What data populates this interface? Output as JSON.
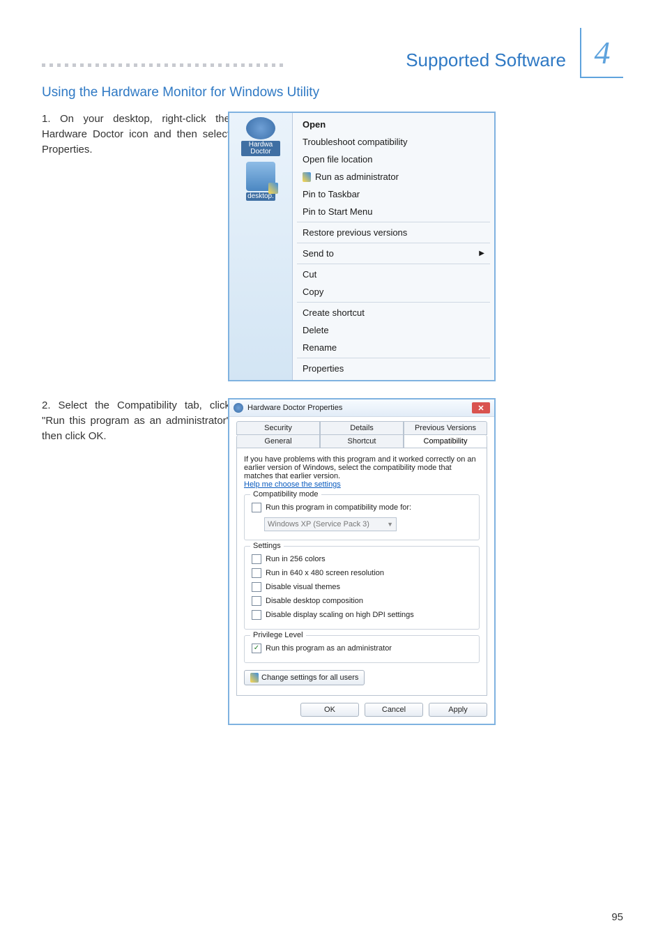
{
  "chapter": {
    "title": "Supported Software",
    "number": "4"
  },
  "section_title": "Using the Hardware Monitor for Windows Utility",
  "step1": {
    "num": "1.",
    "text": "On your desktop, right-click the Hardware Doctor icon and then select Properties."
  },
  "desktop": {
    "hardware_icon_label": "Hardwa\nDoctor",
    "desktop_icon_label": "desktop."
  },
  "context_menu": {
    "open": "Open",
    "troubleshoot": "Troubleshoot compatibility",
    "open_loc": "Open file location",
    "run_admin": "Run as administrator",
    "pin_taskbar": "Pin to Taskbar",
    "pin_start": "Pin to Start Menu",
    "restore": "Restore previous versions",
    "send_to": "Send to",
    "cut": "Cut",
    "copy": "Copy",
    "create_shortcut": "Create shortcut",
    "delete": "Delete",
    "rename": "Rename",
    "properties": "Properties"
  },
  "step2": {
    "num": "2.",
    "text": "Select the Compatibility tab, click \"Run this program as an administrator\" then click OK."
  },
  "dialog": {
    "title": "Hardware Doctor Properties",
    "tabs": {
      "security": "Security",
      "details": "Details",
      "previous": "Previous Versions",
      "general": "General",
      "shortcut": "Shortcut",
      "compatibility": "Compatibility"
    },
    "hint": "If you have problems with this program and it worked correctly on an earlier version of Windows, select the compatibility mode that matches that earlier version.",
    "help_link": "Help me choose the settings",
    "group_compat": "Compatibility mode",
    "chk_compat": "Run this program in compatibility mode for:",
    "compat_option": "Windows XP (Service Pack 3)",
    "group_settings": "Settings",
    "chk_256": "Run in 256 colors",
    "chk_640": "Run in 640 x 480 screen resolution",
    "chk_themes": "Disable visual themes",
    "chk_compose": "Disable desktop composition",
    "chk_dpi": "Disable display scaling on high DPI settings",
    "group_priv": "Privilege Level",
    "chk_admin": "Run this program as an administrator",
    "btn_change": "Change settings for all users",
    "btn_ok": "OK",
    "btn_cancel": "Cancel",
    "btn_apply": "Apply"
  },
  "page_number": "95"
}
